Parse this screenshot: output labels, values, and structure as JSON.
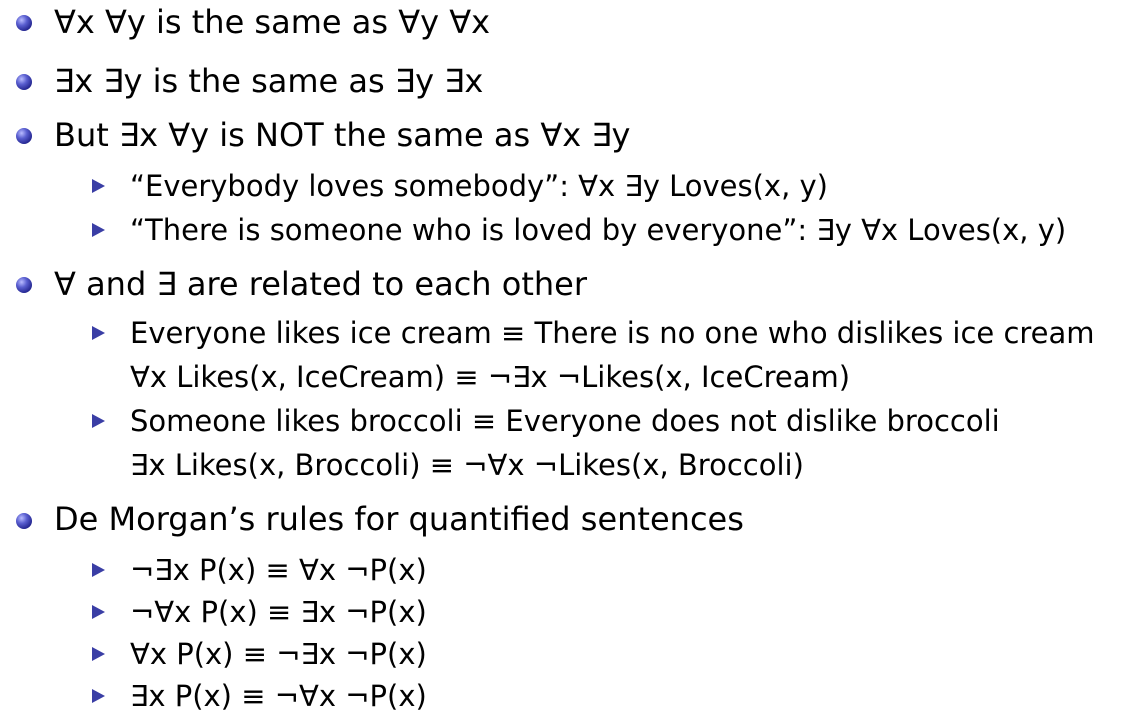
{
  "items": [
    {
      "level": 1,
      "text": "∀x ∀y  is the same as ∀y ∀x"
    },
    {
      "level": 1,
      "text": "∃x ∃y  is the same as ∃y ∃x"
    },
    {
      "level": 1,
      "text": "But ∃x ∀y  is NOT the same as ∀x ∃y"
    },
    {
      "level": 2,
      "text": "“Everybody loves somebody”: ∀x ∃y Loves(x, y)"
    },
    {
      "level": 2,
      "text": "“There is someone who is loved by everyone”: ∃y ∀x Loves(x, y)"
    },
    {
      "level": 1,
      "text": "∀ and ∃ are related to each other"
    },
    {
      "level": 2,
      "text": "Everyone likes ice cream ≡ There is no one who dislikes ice cream"
    },
    {
      "level": 3,
      "text": "∀x Likes(x, IceCream) ≡ ¬∃x ¬Likes(x, IceCream)"
    },
    {
      "level": 2,
      "text": "Someone likes broccoli ≡ Everyone does not dislike broccoli"
    },
    {
      "level": 3,
      "text": "∃x Likes(x, Broccoli) ≡ ¬∀x ¬Likes(x, Broccoli)"
    },
    {
      "level": 1,
      "text": "De Morgan’s rules for quantified sentences"
    },
    {
      "level": 2,
      "text": "¬∃x P(x) ≡ ∀x ¬P(x)"
    },
    {
      "level": 2,
      "text": "¬∀x P(x) ≡ ∃x ¬P(x)"
    },
    {
      "level": 2,
      "text": "∀x P(x) ≡ ¬∃x ¬P(x)"
    },
    {
      "level": 2,
      "text": "∃x P(x) ≡ ¬∀x ¬P(x)"
    }
  ],
  "colors": {
    "bullet_primary": "#3a3ea5",
    "text": "#000000",
    "background": "#ffffff"
  }
}
